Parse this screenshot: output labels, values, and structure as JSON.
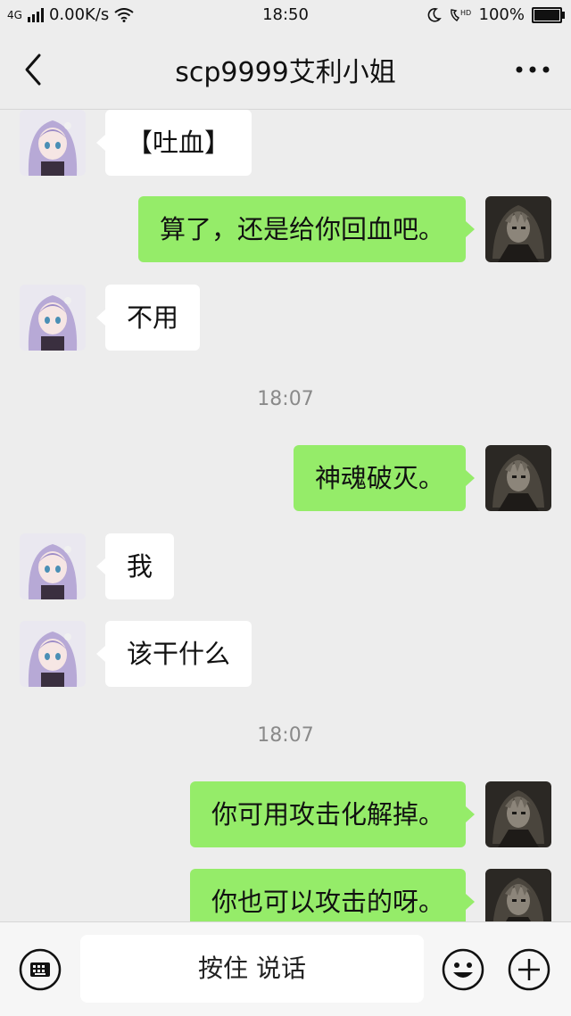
{
  "status": {
    "network": "4G",
    "speed": "0.00K/s",
    "time": "18:50",
    "hd_label": "HD",
    "battery": "100%"
  },
  "header": {
    "title": "scp9999艾利小姐",
    "back_icon": "chevron-left-icon",
    "more_icon": "more-dots-icon"
  },
  "messages": [
    {
      "side": "left",
      "text": "【吐血】"
    },
    {
      "side": "right",
      "text": "算了，还是给你回血吧。"
    },
    {
      "side": "left",
      "text": "不用"
    },
    {
      "type": "time",
      "text": "18:07"
    },
    {
      "side": "right",
      "text": "神魂破灭。"
    },
    {
      "side": "left",
      "text": "我"
    },
    {
      "side": "left",
      "text": "该干什么"
    },
    {
      "type": "time",
      "text": "18:07"
    },
    {
      "side": "right",
      "text": "你可用攻击化解掉。"
    },
    {
      "side": "right",
      "text": "你也可以攻击的呀。"
    }
  ],
  "input_bar": {
    "hold_to_talk": "按住 说话",
    "keyboard_icon": "keyboard-icon",
    "emoji_icon": "emoji-icon",
    "plus_icon": "plus-icon"
  },
  "colors": {
    "background": "#ededed",
    "bubble_self": "#95ec69",
    "bubble_other": "#ffffff"
  }
}
